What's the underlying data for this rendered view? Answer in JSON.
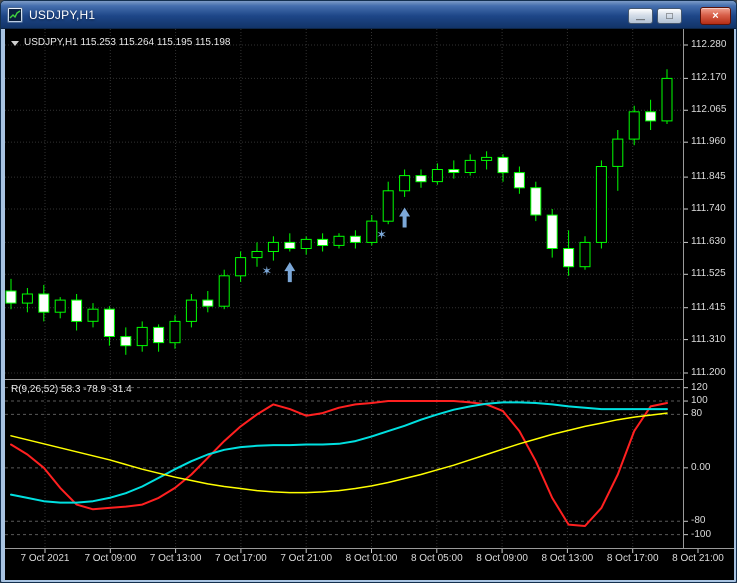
{
  "window": {
    "title": "USDJPY,H1",
    "buttons": {
      "minimize_glyph": "—",
      "maximize_glyph": "□",
      "close_glyph": "×"
    }
  },
  "main_chart": {
    "info_label": "USDJPY,H1 115.253 115.264 115.195 115.198"
  },
  "indicator": {
    "label": "R(9,26,52) 58.3 -78.9 -31.4"
  },
  "axes": {
    "price_labels": [
      "112.280",
      "112.170",
      "112.065",
      "111.960",
      "111.845",
      "111.740",
      "111.630",
      "111.525",
      "111.415",
      "111.310",
      "111.200"
    ],
    "indicator_labels": [
      "120",
      "100",
      "80",
      "0.00",
      "-80",
      "-100"
    ],
    "time_labels": [
      "7 Oct 2021",
      "7 Oct 09:00",
      "7 Oct 13:00",
      "7 Oct 17:00",
      "7 Oct 21:00",
      "8 Oct 01:00",
      "8 Oct 05:00",
      "8 Oct 09:00",
      "8 Oct 13:00",
      "8 Oct 17:00",
      "8 Oct 21:00"
    ]
  },
  "colors": {
    "background": "#000000",
    "grid": "#323232",
    "level_line": "#5a5a5a",
    "candle_outline": "#00ff00",
    "bull_fill": "#000000",
    "bear_fill": "#ffffff",
    "marker_blue": "#7ca8d8",
    "axis_text": "#dcdcdc",
    "separator": "#9a9a9a",
    "indicator_red": "#ff2020",
    "indicator_cyan": "#00e0e0",
    "indicator_yellow": "#ffff00"
  },
  "chart_data": {
    "type": "candlestick+oscillator",
    "symbol": "USDJPY",
    "timeframe": "H1",
    "price_range": [
      111.2,
      112.28
    ],
    "indicator_range": [
      -120,
      130
    ],
    "candles_ohlc": [
      [
        111.47,
        111.51,
        111.41,
        111.43
      ],
      [
        111.43,
        111.48,
        111.4,
        111.46
      ],
      [
        111.46,
        111.49,
        111.37,
        111.4
      ],
      [
        111.4,
        111.45,
        111.38,
        111.44
      ],
      [
        111.44,
        111.46,
        111.34,
        111.37
      ],
      [
        111.37,
        111.43,
        111.35,
        111.41
      ],
      [
        111.41,
        111.42,
        111.29,
        111.32
      ],
      [
        111.32,
        111.35,
        111.26,
        111.29
      ],
      [
        111.29,
        111.37,
        111.27,
        111.35
      ],
      [
        111.35,
        111.36,
        111.27,
        111.3
      ],
      [
        111.3,
        111.39,
        111.28,
        111.37
      ],
      [
        111.37,
        111.46,
        111.35,
        111.44
      ],
      [
        111.44,
        111.47,
        111.4,
        111.42
      ],
      [
        111.42,
        111.54,
        111.41,
        111.52
      ],
      [
        111.52,
        111.6,
        111.5,
        111.58
      ],
      [
        111.58,
        111.63,
        111.55,
        111.6
      ],
      [
        111.6,
        111.65,
        111.57,
        111.63
      ],
      [
        111.63,
        111.66,
        111.6,
        111.61
      ],
      [
        111.61,
        111.65,
        111.59,
        111.64
      ],
      [
        111.64,
        111.66,
        111.6,
        111.62
      ],
      [
        111.62,
        111.66,
        111.61,
        111.65
      ],
      [
        111.65,
        111.67,
        111.61,
        111.63
      ],
      [
        111.63,
        111.72,
        111.62,
        111.7
      ],
      [
        111.7,
        111.83,
        111.69,
        111.8
      ],
      [
        111.8,
        111.87,
        111.78,
        111.85
      ],
      [
        111.85,
        111.87,
        111.81,
        111.83
      ],
      [
        111.83,
        111.89,
        111.82,
        111.87
      ],
      [
        111.87,
        111.9,
        111.84,
        111.86
      ],
      [
        111.86,
        111.92,
        111.85,
        111.9
      ],
      [
        111.9,
        111.93,
        111.87,
        111.91
      ],
      [
        111.91,
        111.92,
        111.83,
        111.86
      ],
      [
        111.86,
        111.88,
        111.79,
        111.81
      ],
      [
        111.81,
        111.83,
        111.7,
        111.72
      ],
      [
        111.72,
        111.74,
        111.58,
        111.61
      ],
      [
        111.61,
        111.67,
        111.52,
        111.55
      ],
      [
        111.55,
        111.65,
        111.54,
        111.63
      ],
      [
        111.63,
        111.9,
        111.61,
        111.88
      ],
      [
        111.88,
        112.0,
        111.8,
        111.97
      ],
      [
        111.97,
        112.08,
        111.95,
        112.06
      ],
      [
        112.06,
        112.1,
        112.0,
        112.03
      ],
      [
        112.03,
        112.2,
        112.02,
        112.17
      ]
    ],
    "markers": {
      "star_glyph": "✶",
      "up_arrows": [
        {
          "index": 17,
          "price": 111.575
        },
        {
          "index": 24,
          "price": 111.755
        }
      ],
      "stars": [
        {
          "index": 15.6,
          "price": 111.535
        },
        {
          "index": 22.6,
          "price": 111.655
        }
      ]
    },
    "oscillator": {
      "name": "R(9,26,52)",
      "values_label": "58.3 -78.9 -31.4",
      "levels": [
        120,
        100,
        80,
        0,
        -80,
        -100
      ],
      "series": [
        {
          "name": "fast-red",
          "color_key": "indicator_red",
          "width": 2,
          "values": [
            35,
            20,
            0,
            -30,
            -55,
            -62,
            -60,
            -58,
            -55,
            -45,
            -30,
            -10,
            15,
            40,
            62,
            80,
            95,
            88,
            78,
            82,
            90,
            95,
            97,
            100,
            100,
            100,
            100,
            100,
            98,
            95,
            85,
            55,
            10,
            -45,
            -85,
            -87,
            -60,
            -10,
            55,
            92,
            97
          ]
        },
        {
          "name": "mid-cyan",
          "color_key": "indicator_cyan",
          "width": 2,
          "values": [
            -40,
            -45,
            -50,
            -52,
            -52,
            -50,
            -45,
            -38,
            -28,
            -15,
            -2,
            10,
            20,
            27,
            31,
            33,
            34,
            34,
            35,
            35,
            36,
            40,
            47,
            55,
            63,
            72,
            80,
            87,
            92,
            96,
            98,
            98,
            97,
            95,
            92,
            90,
            88,
            88,
            88,
            88,
            88
          ]
        },
        {
          "name": "slow-yellow",
          "color_key": "indicator_yellow",
          "width": 1.5,
          "values": [
            48,
            42,
            36,
            30,
            24,
            18,
            12,
            5,
            -2,
            -8,
            -14,
            -19,
            -24,
            -28,
            -31,
            -34,
            -36,
            -37,
            -37,
            -36,
            -34,
            -31,
            -27,
            -22,
            -16,
            -10,
            -3,
            4,
            12,
            20,
            28,
            36,
            43,
            50,
            56,
            62,
            67,
            72,
            76,
            79,
            82
          ]
        }
      ]
    }
  }
}
